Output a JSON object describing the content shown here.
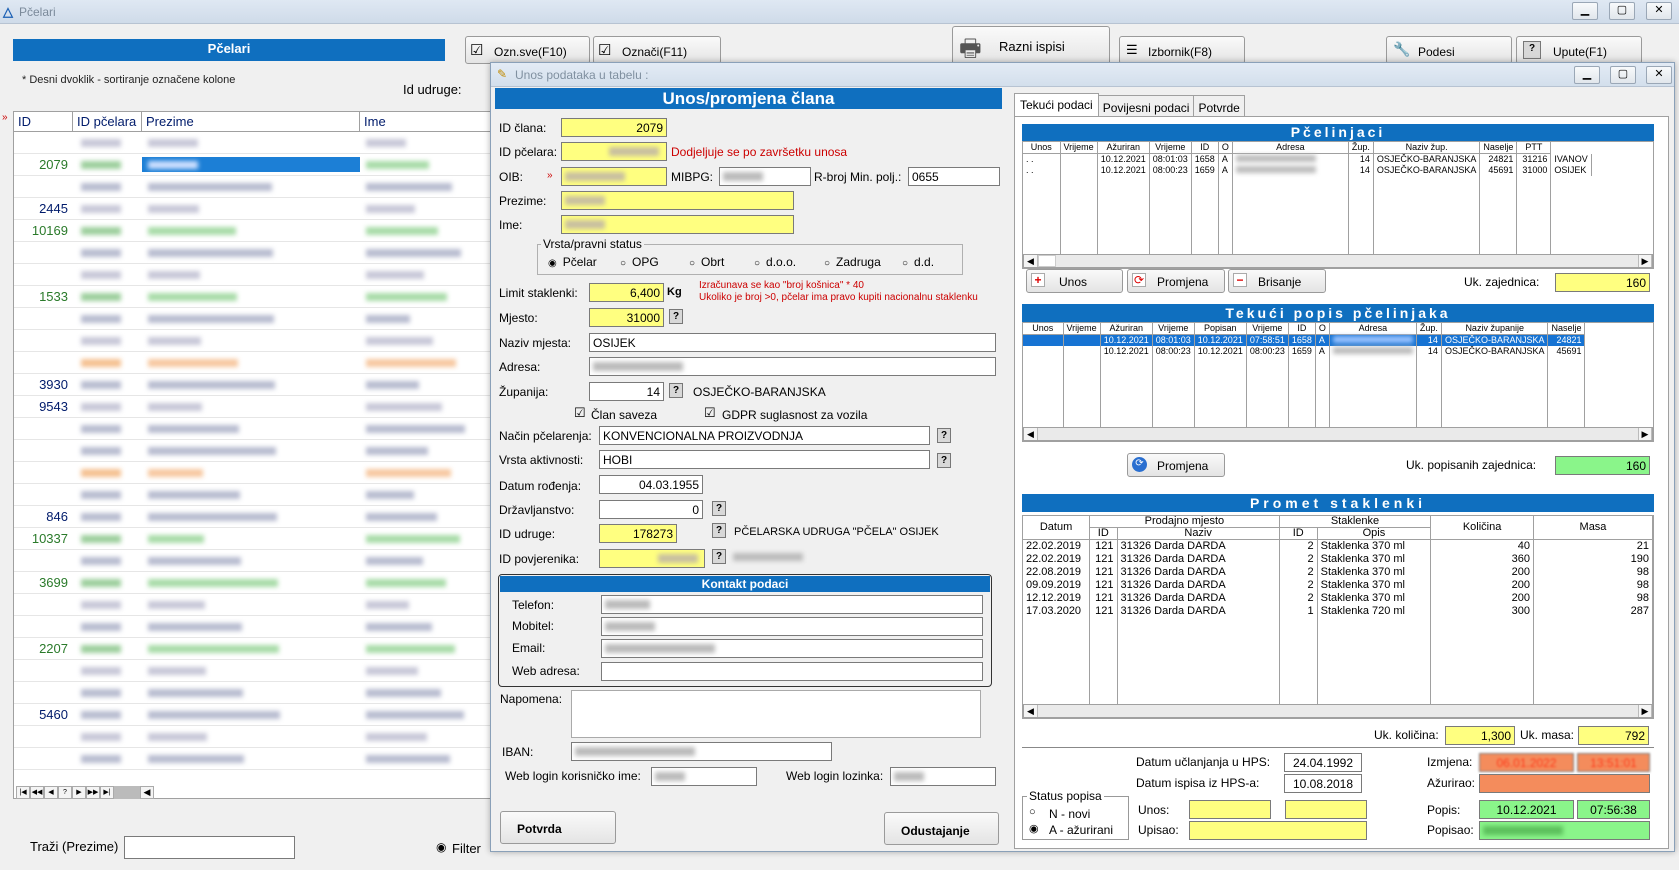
{
  "app": {
    "title": "Pčelari"
  },
  "left": {
    "header": "Pčelari",
    "hint": "* Desni dvoklik - sortiranje označene kolone",
    "id_udruge_label": "Id udruge:",
    "columns": [
      "ID",
      "ID pčelara",
      "Prezime",
      "Ime"
    ],
    "ids": [
      "",
      "2079",
      "",
      "2445",
      "10169",
      "",
      "",
      "1533",
      "",
      "",
      "",
      "3930",
      "9543",
      "",
      "",
      "",
      "",
      "846",
      "10337",
      "",
      "3699",
      "",
      "",
      "2207",
      "",
      "",
      "5460",
      "",
      ""
    ],
    "search_label": "Traži (Prezime)",
    "filter_label": "Filter",
    "nav": [
      "|◀",
      "◀◀",
      "◀",
      "?",
      "▶",
      "▶▶",
      "▶|"
    ]
  },
  "toolbar": {
    "oznsve": "Ozn.sve(F10)",
    "oznaci": "Označi(F11)",
    "ispisi": "Razni ispisi",
    "izbornik": "Izbornik(F8)",
    "podesi": "Podesi",
    "upute": "Upute(F1)"
  },
  "dialog": {
    "title": "Unos podataka u tabelu :",
    "header": "Unos/promjena člana",
    "id_clana_label": "ID člana:",
    "id_clana": "2079",
    "id_pcelara_label": "ID pčelara:",
    "id_pcelara_note": "Dodjeljuje se po završetku unosa",
    "oib_label": "OIB:",
    "mibpg_label": "MIBPG:",
    "rbroj_label": "R-broj Min. polj.:",
    "rbroj": "0655",
    "prezime_label": "Prezime:",
    "ime_label": "Ime:",
    "status_legend": "Vrsta/pravni status",
    "status_options": [
      "Pčelar",
      "OPG",
      "Obrt",
      "d.o.o.",
      "Zadruga",
      "d.d."
    ],
    "limit_label": "Limit staklenki:",
    "limit": "6,400",
    "limit_unit": "Kg",
    "limit_note1": "Izračunava se kao \"broj košnica\" * 40",
    "limit_note2": "Ukoliko je broj >0, pčelar ima pravo kupiti nacionalnu staklenku",
    "mjesto_label": "Mjesto:",
    "mjesto": "31000",
    "naziv_mjesta_label": "Naziv mjesta:",
    "naziv_mjesta": "OSIJEK",
    "adresa_label": "Adresa:",
    "zupanija_label": "Županija:",
    "zupanija": "14",
    "zupanija_naziv": "OSJEČKO-BARANJSKA",
    "clan_saveza": "Član saveza",
    "gdpr": "GDPR suglasnost za vozila",
    "nacin_label": "Način pčelarenja:",
    "nacin": "KONVENCIONALNA PROIZVODNJA",
    "aktivnost_label": "Vrsta aktivnosti:",
    "aktivnost": "HOBI",
    "datum_rod_label": "Datum rođenja:",
    "datum_rod": "04.03.1955",
    "drzavljanstvo_label": "Državljanstvo:",
    "drzavljanstvo": "0",
    "id_udruge_label": "ID udruge:",
    "id_udruge": "178273",
    "udruga_naziv": "PČELARSKA UDRUGA \"PČELA\" OSIJEK",
    "id_povjerenika_label": "ID povjerenika:",
    "kontakt_header": "Kontakt podaci",
    "telefon_label": "Telefon:",
    "mobitel_label": "Mobitel:",
    "email_label": "Email:",
    "web_label": "Web adresa:",
    "napomena_label": "Napomena:",
    "iban_label": "IBAN:",
    "login_label": "Web login korisničko ime:",
    "lozinka_label": "Web login lozinka:",
    "potvrda": "Potvrda",
    "odustajanje": "Odustajanje"
  },
  "tabs": [
    "Tekući podaci",
    "Povijesni podaci",
    "Potvrde"
  ],
  "pcelinjaci": {
    "header": "Pčelinjaci",
    "columns": [
      "Unos",
      "Vrijeme",
      "Ažuriran",
      "Vrijeme",
      "ID",
      "O",
      "Adresa",
      "Žup.",
      "Naziv žup.",
      "Naselje",
      "PTT"
    ],
    "rows": [
      [
        ". .",
        "",
        "10.12.2021",
        "08:01:03",
        "1658",
        "A",
        "",
        "14",
        "OSJEČKO-BARANJSKA",
        "24821",
        "31216",
        "IVANOV"
      ],
      [
        ". .",
        "",
        "10.12.2021",
        "08:00:23",
        "1659",
        "A",
        "",
        "14",
        "OSJEČKO-BARANJSKA",
        "45691",
        "31000",
        "OSIJEK"
      ]
    ],
    "unos": "Unos",
    "promjena": "Promjena",
    "brisanje": "Brisanje",
    "uk_label": "Uk. zajednica:",
    "uk": "160"
  },
  "popis": {
    "header": "Tekući popis pčelinjaka",
    "columns": [
      "Unos",
      "Vrijeme",
      "Ažuriran",
      "Vrijeme",
      "Popisan",
      "Vrijeme",
      "ID",
      "O",
      "Adresa",
      "Žup.",
      "Naziv županije",
      "Naselje"
    ],
    "rows": [
      [
        "",
        "",
        "10.12.2021",
        "08:01:03",
        "10.12.2021",
        "07:58:51",
        "1658",
        "A",
        "",
        "14",
        "OSJEČKO-BARANJSKA",
        "24821"
      ],
      [
        "",
        "",
        "10.12.2021",
        "08:00:23",
        "10.12.2021",
        "08:00:23",
        "1659",
        "A",
        "",
        "14",
        "OSJEČKO-BARANJSKA",
        "45691"
      ]
    ],
    "promjena": "Promjena",
    "uk_label": "Uk. popisanih zajednica:",
    "uk": "160"
  },
  "promet": {
    "header": "Promet staklenki",
    "h_datum": "Datum",
    "h_prodajno": "Prodajno mjesto",
    "h_id": "ID",
    "h_naziv": "Naziv",
    "h_staklenke": "Staklenke",
    "h_sid": "ID",
    "h_opis": "Opis",
    "h_kolicina": "Količina",
    "h_masa": "Masa",
    "rows": [
      [
        "22.02.2019",
        "121",
        "31326 Darda DARDA",
        "2",
        "Staklenka 370 ml",
        "40",
        "21"
      ],
      [
        "22.02.2019",
        "121",
        "31326 Darda DARDA",
        "2",
        "Staklenka 370 ml",
        "360",
        "190"
      ],
      [
        "22.08.2019",
        "121",
        "31326 Darda DARDA",
        "2",
        "Staklenka 370 ml",
        "200",
        "98"
      ],
      [
        "09.09.2019",
        "121",
        "31326 Darda DARDA",
        "2",
        "Staklenka 370 ml",
        "200",
        "98"
      ],
      [
        "12.12.2019",
        "121",
        "31326 Darda DARDA",
        "2",
        "Staklenka 370 ml",
        "200",
        "98"
      ],
      [
        "17.03.2020",
        "121",
        "31326 Darda DARDA",
        "1",
        "Staklenka 720 ml",
        "300",
        "287"
      ]
    ],
    "uk_kol_label": "Uk. količina:",
    "uk_kol": "1,300",
    "uk_masa_label": "Uk. masa:",
    "uk_masa": "792"
  },
  "bottom": {
    "ucl_label": "Datum učlanjanja u HPS:",
    "ucl": "24.04.1992",
    "isp_label": "Datum ispisa iz HPS-a:",
    "isp": "10.08.2018",
    "izmjena_label": "Izmjena:",
    "izmjena_d": "06.01.2022",
    "izmjena_t": "13:51:01",
    "azurirao_label": "Ažurirao:",
    "status_legend": "Status popisa",
    "status_n": "N - novi",
    "status_a": "A - ažurirani",
    "unos_label": "Unos:",
    "upisao_label": "Upisao:",
    "popis_label": "Popis:",
    "popis_d": "10.12.2021",
    "popis_t": "07:56:38",
    "popisao_label": "Popisao:"
  }
}
